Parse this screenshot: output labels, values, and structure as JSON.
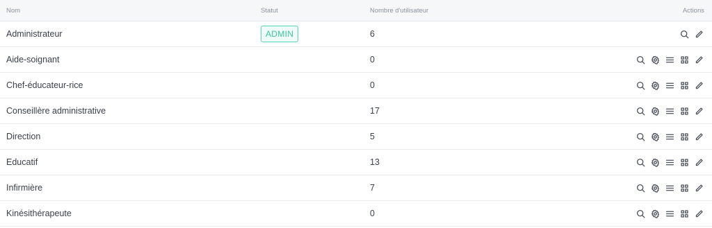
{
  "header": {
    "name": "Nom",
    "statut": "Statut",
    "count": "Nombre d'utilisateur",
    "actions": "Actions"
  },
  "rows": [
    {
      "name": "Administrateur",
      "badge": "ADMIN",
      "count": "6"
    },
    {
      "name": "Aide-soignant",
      "badge": "",
      "count": "0"
    },
    {
      "name": "Chef-éducateur-rice",
      "badge": "",
      "count": "0"
    },
    {
      "name": "Conseillère administrative",
      "badge": "",
      "count": "17"
    },
    {
      "name": "Direction",
      "badge": "",
      "count": "5"
    },
    {
      "name": "Educatif",
      "badge": "",
      "count": "13"
    },
    {
      "name": "Infirmière",
      "badge": "",
      "count": "7"
    },
    {
      "name": "Kinésithérapeute",
      "badge": "",
      "count": "0"
    }
  ],
  "icons": {
    "view": "search-icon",
    "settings": "gear-icon",
    "list": "list-icon",
    "grid": "grid-icon",
    "edit": "pencil-icon"
  },
  "colors": {
    "badge_border": "#5dd3b6",
    "badge_text": "#3cc3a2",
    "header_bg": "#f6f7f9"
  }
}
